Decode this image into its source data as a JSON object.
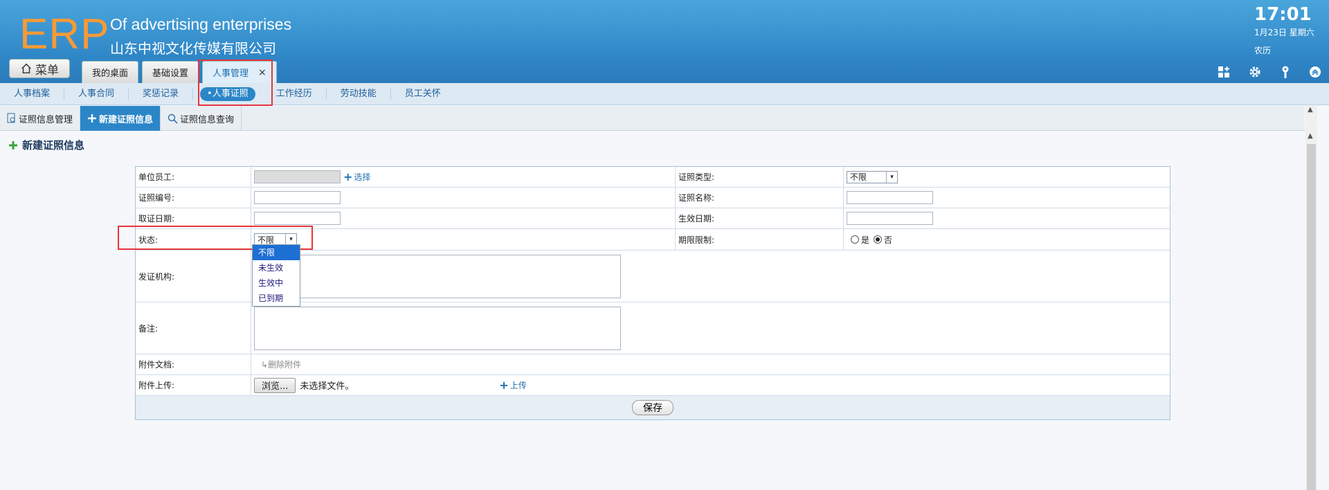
{
  "header": {
    "logo": "ERP",
    "company_en": "Of advertising enterprises",
    "company_cn": "山东中视文化传媒有限公司",
    "menu_label": "菜单",
    "tabs": [
      {
        "label": "我的桌面"
      },
      {
        "label": "基础设置"
      },
      {
        "label": "人事管理",
        "close": "×"
      }
    ],
    "clock": "17:01",
    "date": "1月23日 星期六",
    "lunar": "农历"
  },
  "subnav": {
    "items": [
      "人事档案",
      "人事合同",
      "奖惩记录",
      "•人事证照",
      "工作经历",
      "劳动技能",
      "员工关怀"
    ]
  },
  "page_tabs": [
    "证照信息管理",
    "新建证照信息",
    "证照信息查询"
  ],
  "section_title": "新建证照信息",
  "form": {
    "employee_label": "单位员工:",
    "select_link": "选择",
    "cert_type_label": "证照类型:",
    "cert_type_value": "不限",
    "cert_no_label": "证照编号:",
    "cert_name_label": "证照名称:",
    "obtain_date_label": "取证日期:",
    "effective_date_label": "生效日期:",
    "status_label": "状态:",
    "status_value": "不限",
    "limit_label": "期限限制:",
    "limit_yes": "是",
    "limit_no": "否",
    "issuer_label": "发证机构:",
    "remark_label": "备注:",
    "attach_label": "附件文档:",
    "delete_attach": "删除附件",
    "upload_label": "附件上传:",
    "browse": "浏览...",
    "no_file": "未选择文件。",
    "upload_link": "上传",
    "save": "保存"
  },
  "status_options": [
    "不限",
    "未生效",
    "生效中",
    "已到期"
  ]
}
